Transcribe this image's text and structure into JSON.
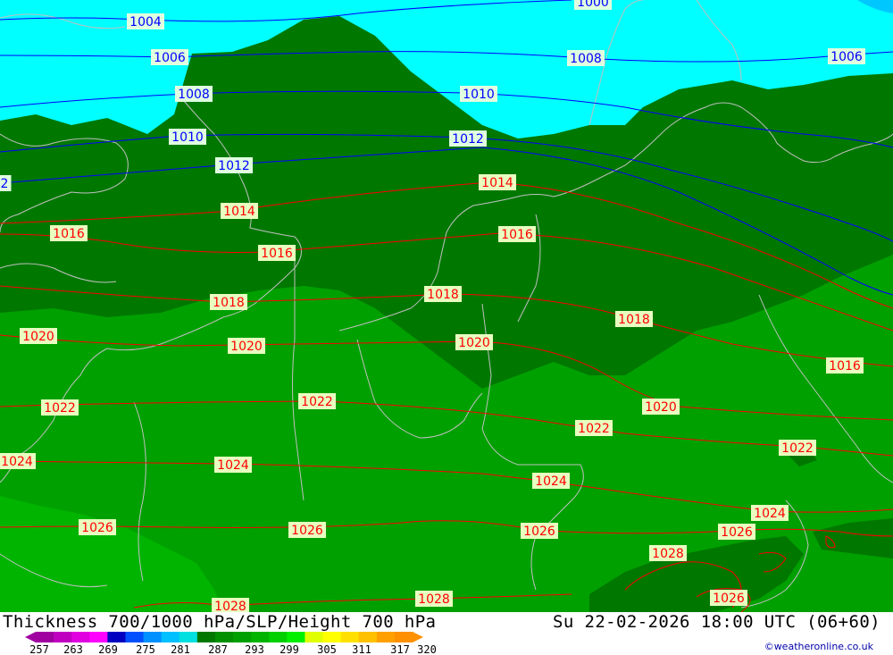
{
  "title": {
    "left": "Thickness 700/1000 hPa/SLP/Height 700 hPa",
    "right": "Su 22-02-2026 18:00 UTC (06+60)"
  },
  "credit": "©weatheronline.co.uk",
  "colors": {
    "sea": "#00ffff",
    "band_dark": "#007800",
    "band_mid": "#00a000",
    "band_light": "#00b400",
    "isobar_low": "#0000ff",
    "isobar_high": "#ff0000",
    "coast": "#c0c0c0"
  },
  "legend": {
    "ticks": [
      "257",
      "263",
      "269",
      "275",
      "281",
      "287",
      "293",
      "299",
      "305",
      "311",
      "317",
      "320"
    ],
    "colors": [
      "#a000a0",
      "#c000c0",
      "#e000e0",
      "#ff00ff",
      "#0000c0",
      "#0050ff",
      "#0090ff",
      "#00c0ff",
      "#00e0e0",
      "#007800",
      "#009000",
      "#00a000",
      "#00b400",
      "#00d000",
      "#00f000",
      "#e0ff00",
      "#ffff00",
      "#ffe000",
      "#ffc000",
      "#ffa000",
      "#ff9000"
    ]
  },
  "isobar_labels": [
    {
      "text": "1004",
      "kind": "low"
    },
    {
      "text": "1006",
      "kind": "low"
    },
    {
      "text": "1008",
      "kind": "low"
    },
    {
      "text": "1010",
      "kind": "low"
    },
    {
      "text": "1012",
      "kind": "low"
    },
    {
      "text": "2",
      "kind": "low"
    },
    {
      "text": "1000",
      "kind": "low"
    },
    {
      "text": "1008",
      "kind": "low"
    },
    {
      "text": "1006",
      "kind": "low"
    },
    {
      "text": "1010",
      "kind": "low"
    },
    {
      "text": "1012",
      "kind": "low"
    },
    {
      "text": "1014",
      "kind": "high"
    },
    {
      "text": "1014",
      "kind": "high"
    },
    {
      "text": "1016",
      "kind": "high"
    },
    {
      "text": "1016",
      "kind": "high"
    },
    {
      "text": "1016",
      "kind": "high"
    },
    {
      "text": "1016",
      "kind": "high"
    },
    {
      "text": "1018",
      "kind": "high"
    },
    {
      "text": "1018",
      "kind": "high"
    },
    {
      "text": "1018",
      "kind": "high"
    },
    {
      "text": "1020",
      "kind": "high"
    },
    {
      "text": "1020",
      "kind": "high"
    },
    {
      "text": "1020",
      "kind": "high"
    },
    {
      "text": "1020",
      "kind": "high"
    },
    {
      "text": "1022",
      "kind": "high"
    },
    {
      "text": "1022",
      "kind": "high"
    },
    {
      "text": "1022",
      "kind": "high"
    },
    {
      "text": "1022",
      "kind": "high"
    },
    {
      "text": "1024",
      "kind": "high"
    },
    {
      "text": "1024",
      "kind": "high"
    },
    {
      "text": "1024",
      "kind": "high"
    },
    {
      "text": "1024",
      "kind": "high"
    },
    {
      "text": "1026",
      "kind": "high"
    },
    {
      "text": "1026",
      "kind": "high"
    },
    {
      "text": "1026",
      "kind": "high"
    },
    {
      "text": "1026",
      "kind": "high"
    },
    {
      "text": "1026",
      "kind": "high"
    },
    {
      "text": "1028",
      "kind": "high"
    },
    {
      "text": "1028",
      "kind": "high"
    },
    {
      "text": "1028",
      "kind": "high"
    }
  ]
}
